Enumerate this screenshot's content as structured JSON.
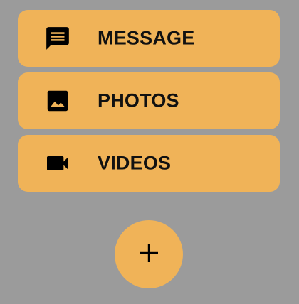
{
  "menu": {
    "items": [
      {
        "label": "MESSAGE",
        "icon": "message-icon"
      },
      {
        "label": "PHOTOS",
        "icon": "image-icon"
      },
      {
        "label": "VIDEOS",
        "icon": "videocam-icon"
      }
    ]
  },
  "fab": {
    "icon": "plus-icon"
  },
  "colors": {
    "background": "#9b9b9b",
    "accent": "#f0b358",
    "text": "#111111"
  }
}
